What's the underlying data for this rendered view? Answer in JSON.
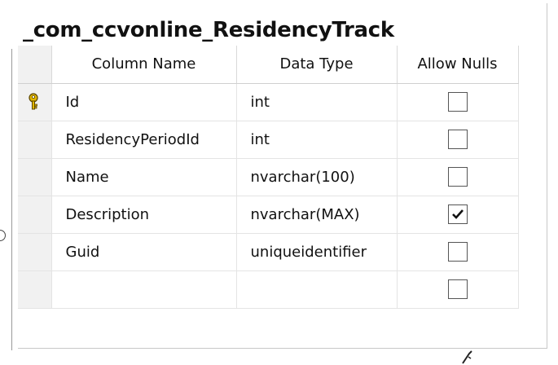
{
  "table": {
    "title": "_com_ccvonline_ResidencyTrack",
    "headers": {
      "column_name": "Column Name",
      "data_type": "Data Type",
      "allow_nulls": "Allow Nulls"
    },
    "rows": [
      {
        "name": "Id",
        "type": "int",
        "allow_nulls": false,
        "primary_key": true
      },
      {
        "name": "ResidencyPeriodId",
        "type": "int",
        "allow_nulls": false,
        "primary_key": false
      },
      {
        "name": "Name",
        "type": "nvarchar(100)",
        "allow_nulls": false,
        "primary_key": false
      },
      {
        "name": "Description",
        "type": "nvarchar(MAX)",
        "allow_nulls": true,
        "primary_key": false
      },
      {
        "name": "Guid",
        "type": "uniqueidentifier",
        "allow_nulls": false,
        "primary_key": false
      },
      {
        "name": "",
        "type": "",
        "allow_nulls": false,
        "primary_key": false
      }
    ]
  },
  "icons": {
    "primary_key": "key-icon",
    "checkbox": "checkbox-icon",
    "checkmark": "checkmark-icon"
  },
  "colors": {
    "selector_column": "#f1f1f1",
    "key_icon": "#e3b800",
    "grid_line": "#e4e4e4"
  }
}
